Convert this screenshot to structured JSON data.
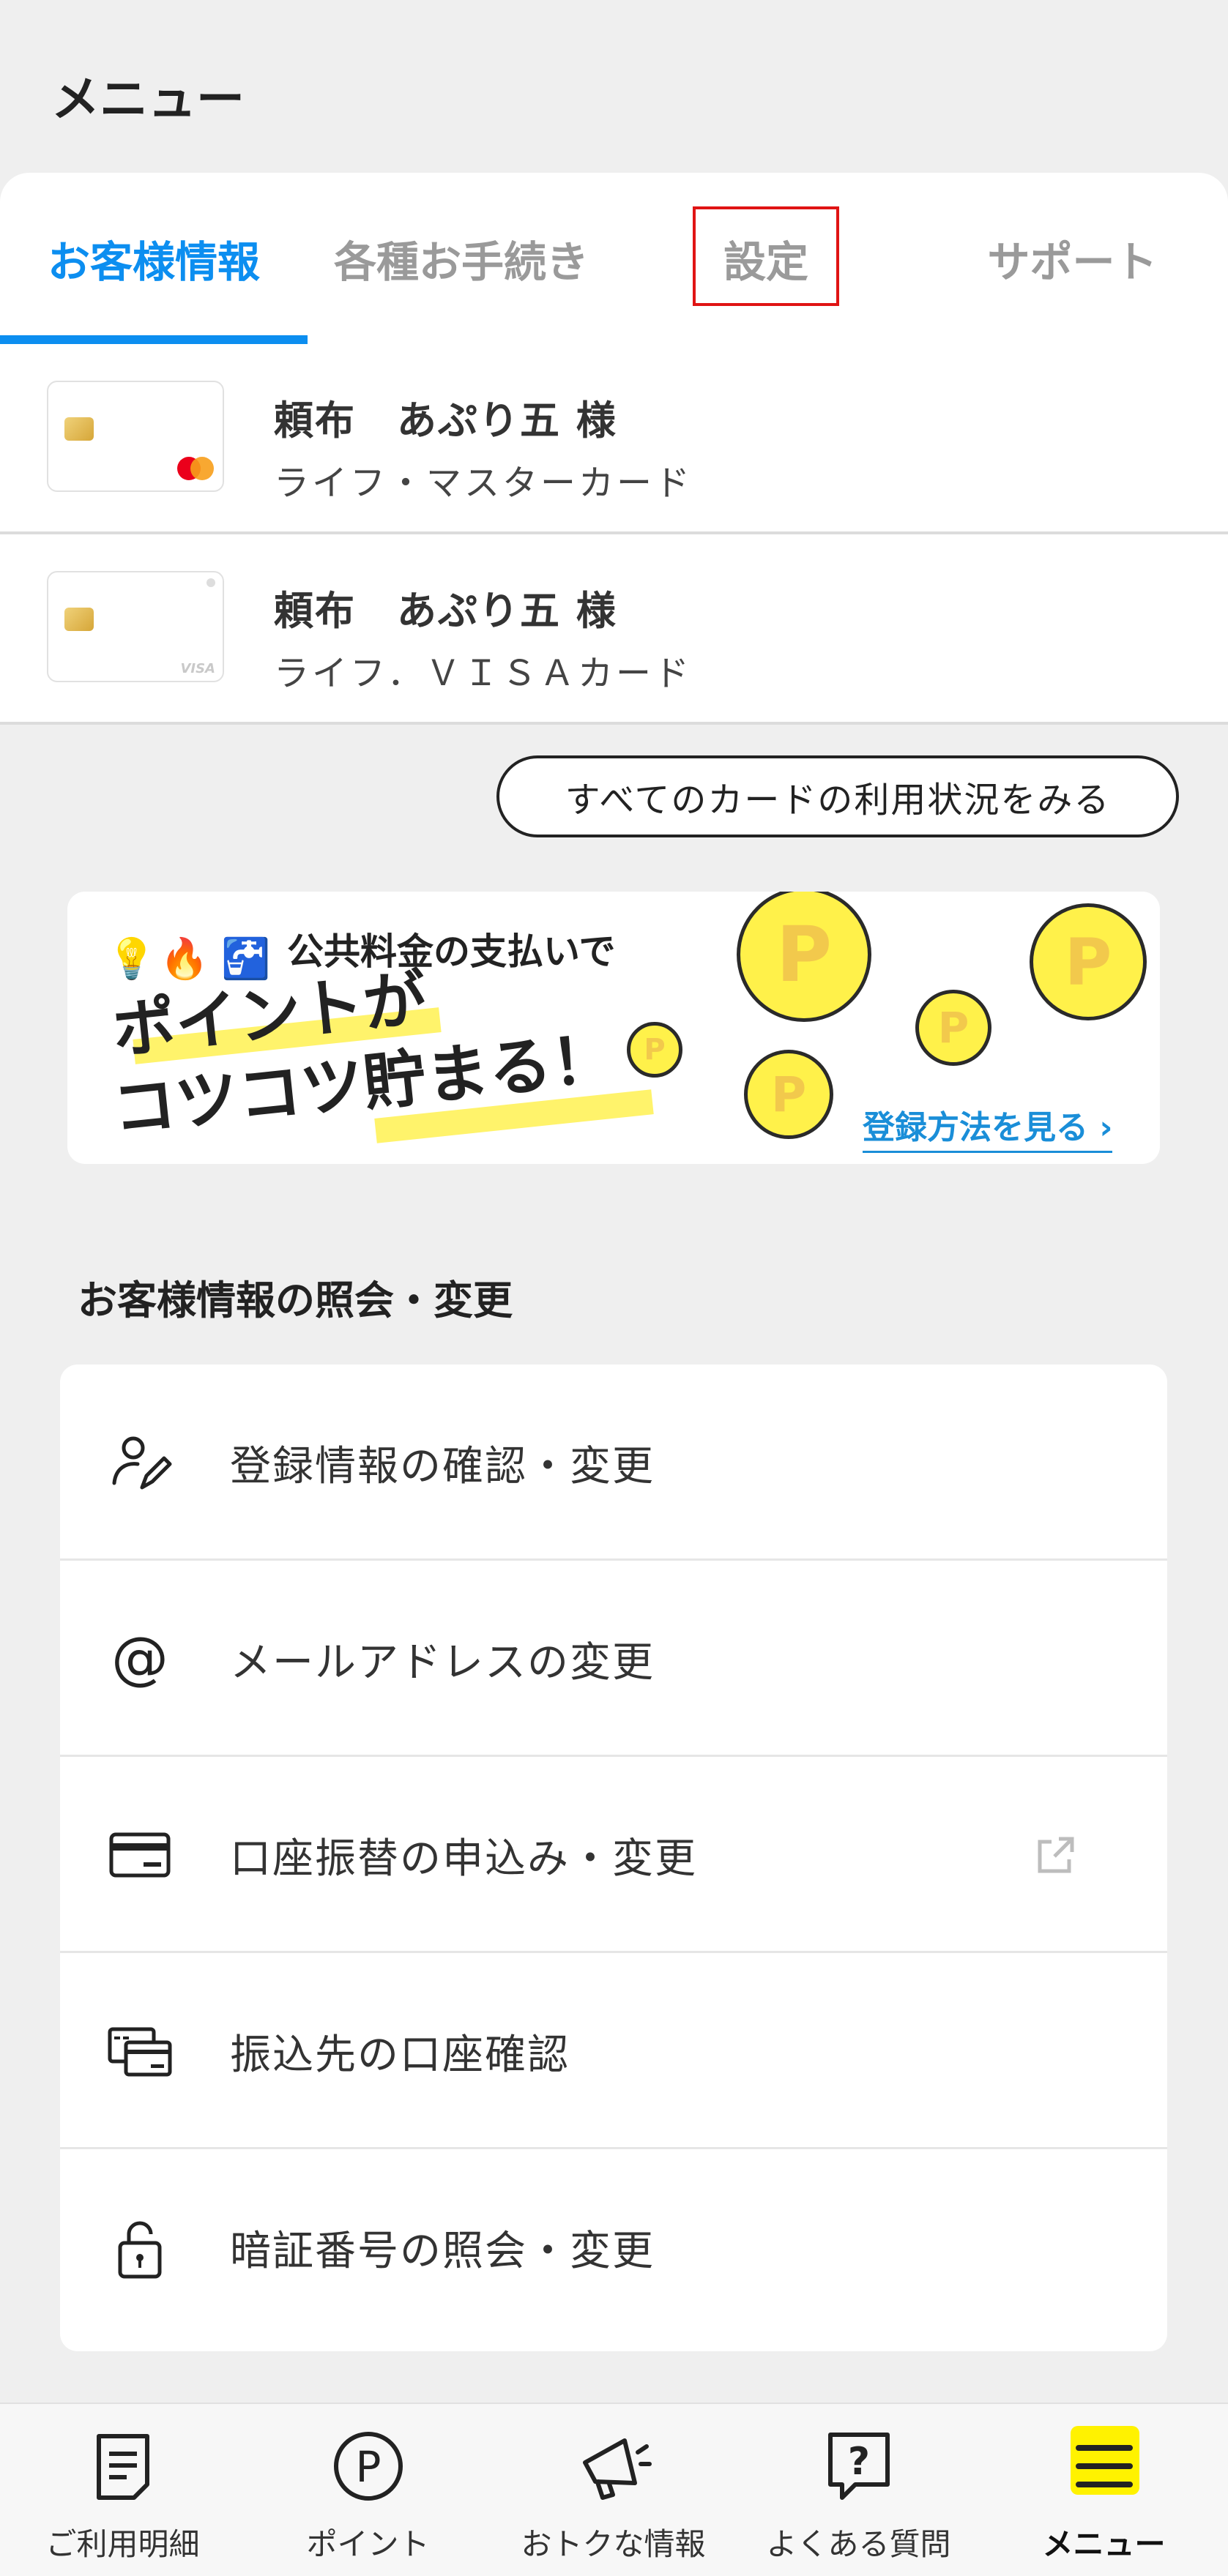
{
  "header": {
    "title": "メニュー"
  },
  "tabs": [
    {
      "label": "お客様情報",
      "active": true
    },
    {
      "label": "各種お手続き",
      "active": false
    },
    {
      "label": "設定",
      "active": false,
      "highlighted": true
    },
    {
      "label": "サポート",
      "active": false
    }
  ],
  "cards": [
    {
      "name": "頼布　あぷり五 様",
      "type": "ライフ・マスターカード",
      "brand": "mastercard"
    },
    {
      "name": "頼布　あぷり五 様",
      "type": "ライフ．ＶＩＳＡカード",
      "brand": "visa"
    }
  ],
  "all_cards_button": "すべてのカードの利用状況をみる",
  "banner": {
    "subtitle": "公共料金の支払いで",
    "main_line1": "ポイントが",
    "main_line2": "コツコツ貯まる！",
    "link": "登録方法を見る ›",
    "coin_label": "P"
  },
  "section": {
    "title": "お客様情報の照会・変更"
  },
  "menu_items": [
    {
      "label": "登録情報の確認・変更",
      "icon": "user-edit-icon",
      "external": false
    },
    {
      "label": "メールアドレスの変更",
      "icon": "at-sign-icon",
      "external": false
    },
    {
      "label": "口座振替の申込み・変更",
      "icon": "credit-card-icon",
      "external": true
    },
    {
      "label": "振込先の口座確認",
      "icon": "bank-transfer-icon",
      "external": false
    },
    {
      "label": "暗証番号の照会・変更",
      "icon": "lock-icon",
      "external": false
    }
  ],
  "bottom_nav": [
    {
      "label": "ご利用明細",
      "icon": "statement-icon",
      "active": false
    },
    {
      "label": "ポイント",
      "icon": "point-icon",
      "active": false
    },
    {
      "label": "おトクな情報",
      "icon": "megaphone-icon",
      "active": false
    },
    {
      "label": "よくある質問",
      "icon": "question-icon",
      "active": false
    },
    {
      "label": "メニュー",
      "icon": "menu-icon",
      "active": true
    }
  ],
  "colors": {
    "accent": "#0c8ef0",
    "highlight_border": "#e01414",
    "banner_yellow": "#fff36b",
    "coin_yellow": "#fff14a",
    "nav_active_bg": "#fff200"
  }
}
